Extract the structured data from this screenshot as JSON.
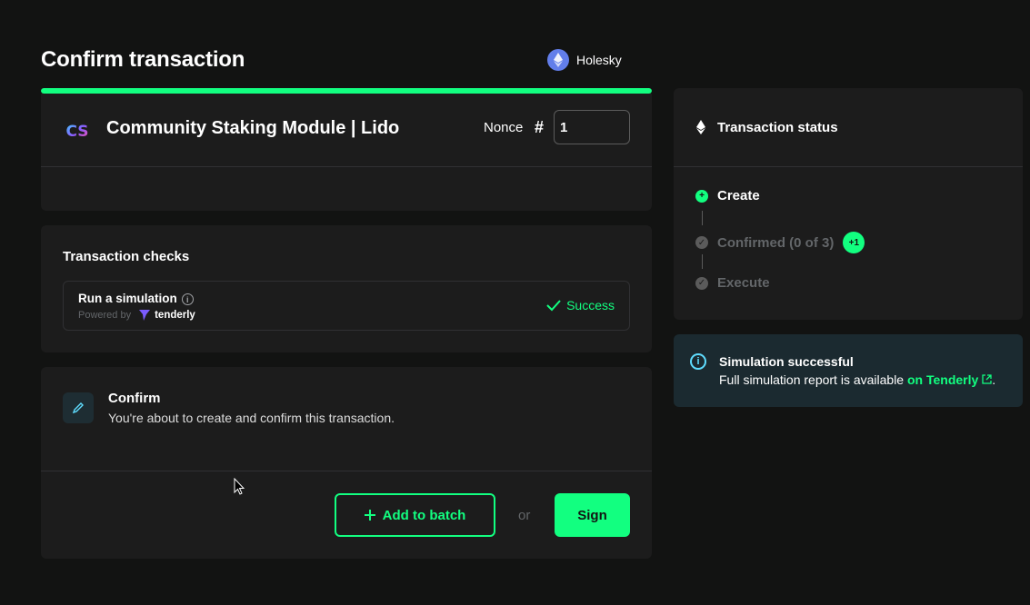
{
  "page": {
    "title": "Confirm transaction"
  },
  "network": {
    "name": "Holesky",
    "icon": "ethereum-icon",
    "color": "#627eea"
  },
  "progress": {
    "percent": 100,
    "color": "#12ff80"
  },
  "tx_header": {
    "module_name": "Community Staking Module | Lido",
    "logo_text": "CS",
    "nonce_label": "Nonce",
    "nonce_hash": "#",
    "nonce_value": "1"
  },
  "checks": {
    "title": "Transaction checks",
    "simulation": {
      "title": "Run a simulation",
      "powered_by": "Powered by",
      "provider": "tenderly",
      "status": "Success"
    }
  },
  "confirm": {
    "title": "Confirm",
    "description": "You're about to create and confirm this transaction.",
    "add_to_batch_label": "Add to batch",
    "or_label": "or",
    "sign_label": "Sign"
  },
  "status": {
    "title": "Transaction status",
    "steps": [
      {
        "label": "Create",
        "state": "done"
      },
      {
        "label": "Confirmed (0 of 3)",
        "state": "pending",
        "badge": "+1"
      },
      {
        "label": "Execute",
        "state": "pending"
      }
    ]
  },
  "alert": {
    "title": "Simulation successful",
    "text": "Full simulation report is available ",
    "link_label": "on Tenderly",
    "suffix": "."
  },
  "colors": {
    "accent": "#12ff80",
    "info": "#5fddff",
    "background": "#121312",
    "card": "#1c1c1c"
  }
}
